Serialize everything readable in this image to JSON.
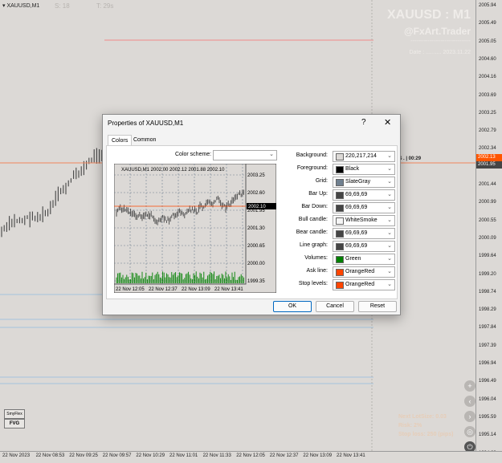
{
  "chart": {
    "symbol_label": "XAUUSD,M1",
    "spread_label": "S: 18",
    "timer_label": "T: 29s",
    "watermark_symbol": "XAUUSD : M1",
    "watermark_brand": "@FxArt.Trader",
    "watermark_rule": "--------------------------------",
    "watermark_date": "Date : .......... 2023.11.22",
    "countdown_label": "$ . | 00:29",
    "info_lot": "Next LotSize: 0.03",
    "info_risk": "Risk: 2%",
    "info_stoploss": "Stop loss: 250 (pips)",
    "side_button_1": "SmyFlex",
    "side_button_2": "FVG",
    "nav_icons": [
      "plus-icon",
      "chevron-left-icon",
      "chevron-right-icon",
      "target-icon",
      "power-icon"
    ],
    "nav_glyphs": [
      "+",
      "‹",
      "›",
      "◎",
      "⏻"
    ]
  },
  "price_axis": {
    "labels": [
      "2005.94",
      "2005.49",
      "2005.05",
      "2004.60",
      "2004.16",
      "2003.69",
      "2003.25",
      "2002.79",
      "2002.34",
      "2001.90",
      "2001.44",
      "2000.99",
      "2000.55",
      "2000.09",
      "1999.64",
      "1999.20",
      "1998.74",
      "1998.29",
      "1997.84",
      "1997.39",
      "1996.94",
      "1996.49",
      "1996.04",
      "1995.59",
      "1995.14",
      "1994.69"
    ],
    "ask_tag": "2002.13",
    "bid_tag": "2001.95",
    "ask_color": "#ff5500",
    "bid_color": "#454545"
  },
  "time_axis": {
    "labels": [
      "22 Nov 2023",
      "22 Nov 08:53",
      "22 Nov 09:25",
      "22 Nov 09:57",
      "22 Nov 10:29",
      "22 Nov 11:01",
      "22 Nov 11:33",
      "22 Nov 12:05",
      "22 Nov 12:37",
      "22 Nov 13:09",
      "22 Nov 13:41"
    ]
  },
  "dialog": {
    "title": "Properties of XAUUSD,M1",
    "help": "?",
    "close": "✕",
    "tabs": [
      {
        "label": "Colors"
      },
      {
        "label": "Common"
      }
    ],
    "scheme_label": "Color scheme:",
    "scheme_value": "",
    "preview": {
      "header": "XAUUSD,M1  2002.00 2002.12 2001.88 2002.10",
      "price_labels": [
        "2003.25",
        "2002.60",
        "2001.95",
        "2001.30",
        "2000.65",
        "2000.00",
        "1999.35"
      ],
      "price_tag": "2002.10",
      "time_labels": [
        "22 Nov 12:05",
        "22 Nov 12:37",
        "22 Nov 13:09",
        "22 Nov 13:41"
      ]
    },
    "properties": [
      {
        "label": "Background:",
        "value": "220,217,214",
        "color": "#dcd9d6"
      },
      {
        "label": "Foreground:",
        "value": "Black",
        "color": "#000000"
      },
      {
        "label": "Grid:",
        "value": "SlateGray",
        "color": "#708090"
      },
      {
        "label": "Bar Up:",
        "value": "69,69,69",
        "color": "#454545"
      },
      {
        "label": "Bar Down:",
        "value": "69,69,69",
        "color": "#454545"
      },
      {
        "label": "Bull candle:",
        "value": "WhiteSmoke",
        "color": "#f5f5f5"
      },
      {
        "label": "Bear candle:",
        "value": "69,69,69",
        "color": "#454545"
      },
      {
        "label": "Line graph:",
        "value": "69,69,69",
        "color": "#454545"
      },
      {
        "label": "Volumes:",
        "value": "Green",
        "color": "#008000"
      },
      {
        "label": "Ask line:",
        "value": "OrangeRed",
        "color": "#ff4500"
      },
      {
        "label": "Stop levels:",
        "value": "OrangeRed",
        "color": "#ff4500"
      }
    ],
    "buttons": {
      "ok": "OK",
      "cancel": "Cancel",
      "reset": "Reset"
    }
  }
}
